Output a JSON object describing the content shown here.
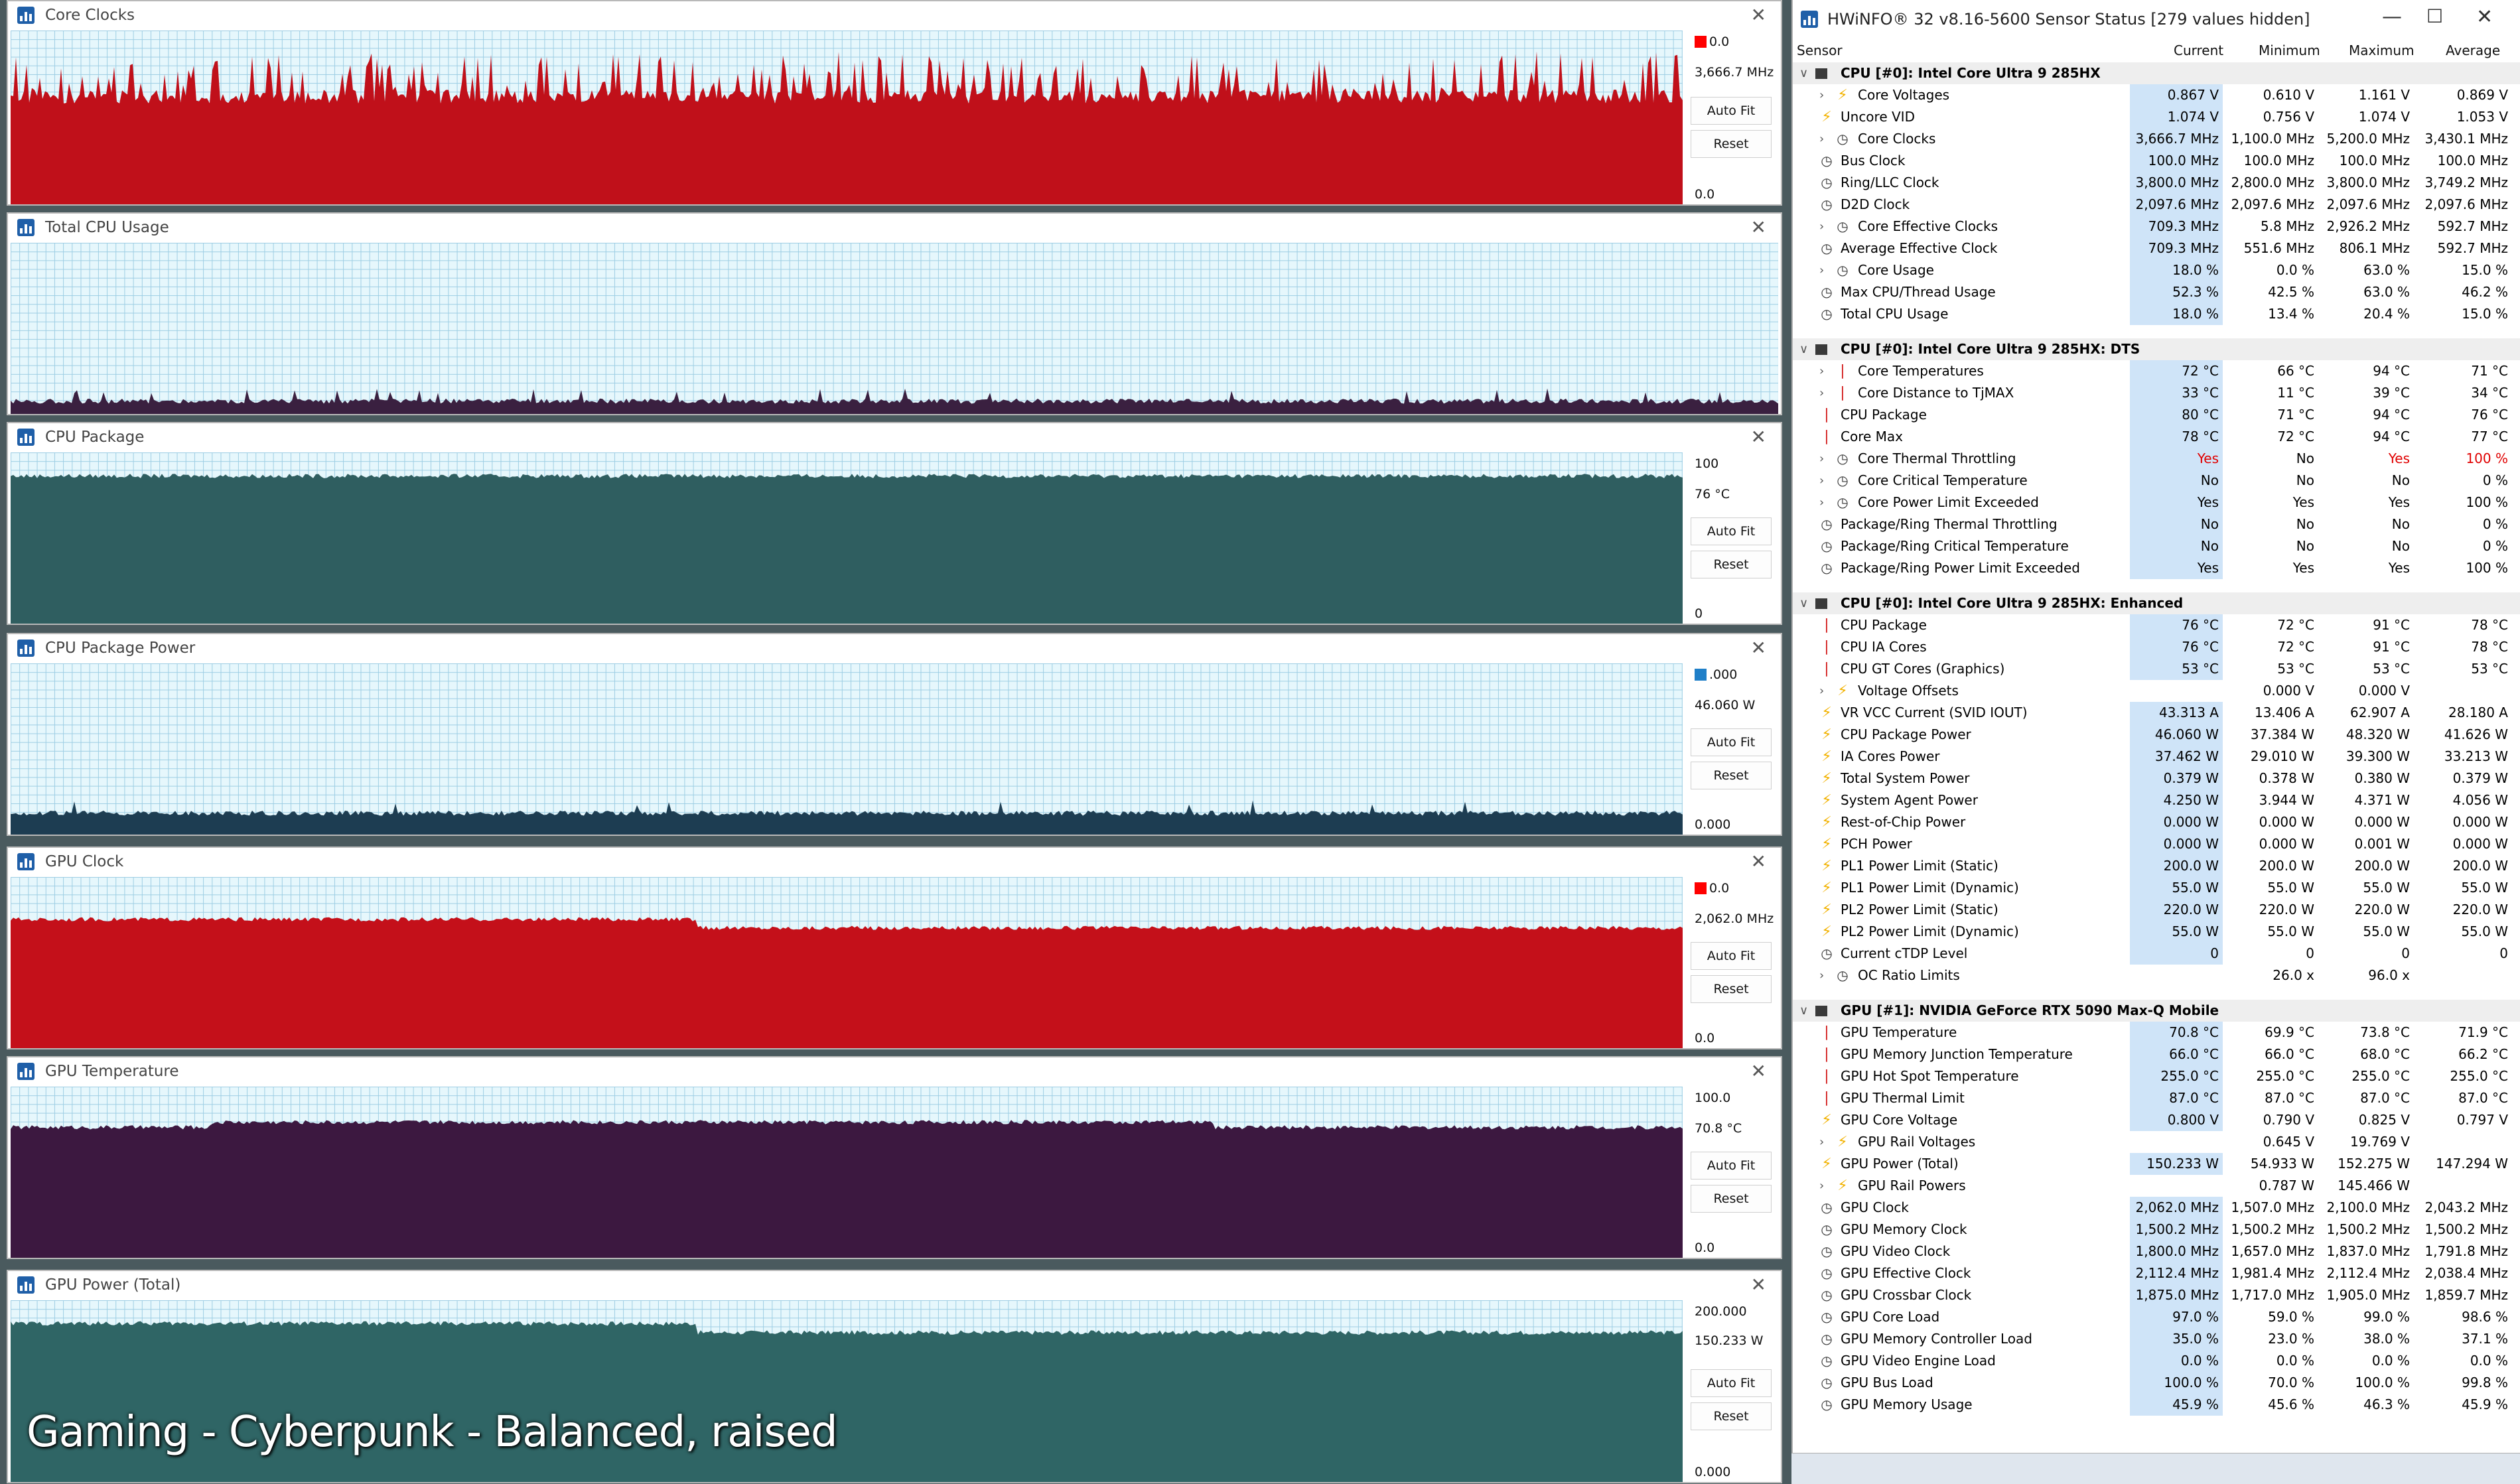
{
  "graphs": [
    {
      "title": "Core Clocks",
      "top_value": "0.0",
      "current": "3,666.7 MHz",
      "bottom_value": "0.0",
      "auto_fit": "Auto Fit",
      "reset": "Reset",
      "color": "#c0101a",
      "swatch": "#ff0000"
    },
    {
      "title": "Total CPU Usage",
      "top_value": "",
      "current": "",
      "bottom_value": "",
      "auto_fit": "",
      "reset": "",
      "color": "#3a2040",
      "swatch": ""
    },
    {
      "title": "CPU Package",
      "top_value": "100",
      "current": "76 °C",
      "bottom_value": "0",
      "auto_fit": "Auto Fit",
      "reset": "Reset",
      "color": "#2f5e60",
      "swatch": ""
    },
    {
      "title": "CPU Package Power",
      "top_value": ".000",
      "current": "46.060 W",
      "bottom_value": "0.000",
      "auto_fit": "Auto Fit",
      "reset": "Reset",
      "color": "#1d3d52",
      "swatch": "#1f7fc8"
    },
    {
      "title": "GPU Clock",
      "top_value": "0.0",
      "current": "2,062.0 MHz",
      "bottom_value": "0.0",
      "auto_fit": "Auto Fit",
      "reset": "Reset",
      "color": "#c4101a",
      "swatch": "#ff0000"
    },
    {
      "title": "GPU Temperature",
      "top_value": "100.0",
      "current": "70.8 °C",
      "bottom_value": "0.0",
      "auto_fit": "Auto Fit",
      "reset": "Reset",
      "color": "#3c1840",
      "swatch": ""
    },
    {
      "title": "GPU Power (Total)",
      "top_value": "200.000",
      "current": "150.233 W",
      "bottom_value": "0.000",
      "auto_fit": "Auto Fit",
      "reset": "Reset",
      "color": "#2f6565",
      "swatch": ""
    }
  ],
  "caption": "Gaming - Cyberpunk - Balanced, raised",
  "sensor_window": {
    "title": "HWiNFO® 32 v8.16-5600 Sensor Status [279 values hidden]",
    "columns": {
      "sensor": "Sensor",
      "current": "Current",
      "minimum": "Minimum",
      "maximum": "Maximum",
      "average": "Average"
    },
    "groups": [
      {
        "name": "CPU [#0]: Intel Core Ultra 9 285HX",
        "rows": [
          {
            "icon": "bolt",
            "expand": true,
            "name": "Core Voltages",
            "cur": "0.867 V",
            "min": "0.610 V",
            "max": "1.161 V",
            "avg": "0.869 V"
          },
          {
            "icon": "bolt",
            "expand": false,
            "name": "Uncore VID",
            "cur": "1.074 V",
            "min": "0.756 V",
            "max": "1.074 V",
            "avg": "1.053 V"
          },
          {
            "icon": "clock",
            "expand": true,
            "name": "Core Clocks",
            "cur": "3,666.7 MHz",
            "min": "1,100.0 MHz",
            "max": "5,200.0 MHz",
            "avg": "3,430.1 MHz"
          },
          {
            "icon": "clock",
            "expand": false,
            "name": "Bus Clock",
            "cur": "100.0 MHz",
            "min": "100.0 MHz",
            "max": "100.0 MHz",
            "avg": "100.0 MHz"
          },
          {
            "icon": "clock",
            "expand": false,
            "name": "Ring/LLC Clock",
            "cur": "3,800.0 MHz",
            "min": "2,800.0 MHz",
            "max": "3,800.0 MHz",
            "avg": "3,749.2 MHz"
          },
          {
            "icon": "clock",
            "expand": false,
            "name": "D2D Clock",
            "cur": "2,097.6 MHz",
            "min": "2,097.6 MHz",
            "max": "2,097.6 MHz",
            "avg": "2,097.6 MHz"
          },
          {
            "icon": "clock",
            "expand": true,
            "name": "Core Effective Clocks",
            "cur": "709.3 MHz",
            "min": "5.8 MHz",
            "max": "2,926.2 MHz",
            "avg": "592.7 MHz"
          },
          {
            "icon": "clock",
            "expand": false,
            "name": "Average Effective Clock",
            "cur": "709.3 MHz",
            "min": "551.6 MHz",
            "max": "806.1 MHz",
            "avg": "592.7 MHz"
          },
          {
            "icon": "clock",
            "expand": true,
            "name": "Core Usage",
            "cur": "18.0 %",
            "min": "0.0 %",
            "max": "63.0 %",
            "avg": "15.0 %"
          },
          {
            "icon": "clock",
            "expand": false,
            "name": "Max CPU/Thread Usage",
            "cur": "52.3 %",
            "min": "42.5 %",
            "max": "63.0 %",
            "avg": "46.2 %"
          },
          {
            "icon": "clock",
            "expand": false,
            "name": "Total CPU Usage",
            "cur": "18.0 %",
            "min": "13.4 %",
            "max": "20.4 %",
            "avg": "15.0 %"
          }
        ]
      },
      {
        "name": "CPU [#0]: Intel Core Ultra 9 285HX: DTS",
        "rows": [
          {
            "icon": "therm",
            "expand": true,
            "name": "Core Temperatures",
            "cur": "72 °C",
            "min": "66 °C",
            "max": "94 °C",
            "avg": "71 °C"
          },
          {
            "icon": "therm",
            "expand": true,
            "name": "Core Distance to TjMAX",
            "cur": "33 °C",
            "min": "11 °C",
            "max": "39 °C",
            "avg": "34 °C"
          },
          {
            "icon": "therm",
            "expand": false,
            "name": "CPU Package",
            "cur": "80 °C",
            "min": "71 °C",
            "max": "94 °C",
            "avg": "76 °C"
          },
          {
            "icon": "therm",
            "expand": false,
            "name": "Core Max",
            "cur": "78 °C",
            "min": "72 °C",
            "max": "94 °C",
            "avg": "77 °C"
          },
          {
            "icon": "clock",
            "expand": true,
            "name": "Core Thermal Throttling",
            "cur": "Yes",
            "min": "No",
            "max": "Yes",
            "avg": "100 %",
            "red": true
          },
          {
            "icon": "clock",
            "expand": true,
            "name": "Core Critical Temperature",
            "cur": "No",
            "min": "No",
            "max": "No",
            "avg": "0 %"
          },
          {
            "icon": "clock",
            "expand": true,
            "name": "Core Power Limit Exceeded",
            "cur": "Yes",
            "min": "Yes",
            "max": "Yes",
            "avg": "100 %"
          },
          {
            "icon": "clock",
            "expand": false,
            "name": "Package/Ring Thermal Throttling",
            "cur": "No",
            "min": "No",
            "max": "No",
            "avg": "0 %"
          },
          {
            "icon": "clock",
            "expand": false,
            "name": "Package/Ring Critical Temperature",
            "cur": "No",
            "min": "No",
            "max": "No",
            "avg": "0 %"
          },
          {
            "icon": "clock",
            "expand": false,
            "name": "Package/Ring Power Limit Exceeded",
            "cur": "Yes",
            "min": "Yes",
            "max": "Yes",
            "avg": "100 %"
          }
        ]
      },
      {
        "name": "CPU [#0]: Intel Core Ultra 9 285HX: Enhanced",
        "rows": [
          {
            "icon": "therm",
            "expand": false,
            "name": "CPU Package",
            "cur": "76 °C",
            "min": "72 °C",
            "max": "91 °C",
            "avg": "78 °C"
          },
          {
            "icon": "therm",
            "expand": false,
            "name": "CPU IA Cores",
            "cur": "76 °C",
            "min": "72 °C",
            "max": "91 °C",
            "avg": "78 °C"
          },
          {
            "icon": "therm",
            "expand": false,
            "name": "CPU GT Cores (Graphics)",
            "cur": "53 °C",
            "min": "53 °C",
            "max": "53 °C",
            "avg": "53 °C"
          },
          {
            "icon": "bolt",
            "expand": true,
            "name": "Voltage Offsets",
            "cur": "",
            "min": "0.000 V",
            "max": "0.000 V",
            "avg": ""
          },
          {
            "icon": "bolt",
            "expand": false,
            "name": "VR VCC Current (SVID IOUT)",
            "cur": "43.313 A",
            "min": "13.406 A",
            "max": "62.907 A",
            "avg": "28.180 A"
          },
          {
            "icon": "bolt",
            "expand": false,
            "name": "CPU Package Power",
            "cur": "46.060 W",
            "min": "37.384 W",
            "max": "48.320 W",
            "avg": "41.626 W"
          },
          {
            "icon": "bolt",
            "expand": false,
            "name": "IA Cores Power",
            "cur": "37.462 W",
            "min": "29.010 W",
            "max": "39.300 W",
            "avg": "33.213 W"
          },
          {
            "icon": "bolt",
            "expand": false,
            "name": "Total System Power",
            "cur": "0.379 W",
            "min": "0.378 W",
            "max": "0.380 W",
            "avg": "0.379 W"
          },
          {
            "icon": "bolt",
            "expand": false,
            "name": "System Agent Power",
            "cur": "4.250 W",
            "min": "3.944 W",
            "max": "4.371 W",
            "avg": "4.056 W"
          },
          {
            "icon": "bolt",
            "expand": false,
            "name": "Rest-of-Chip Power",
            "cur": "0.000 W",
            "min": "0.000 W",
            "max": "0.000 W",
            "avg": "0.000 W"
          },
          {
            "icon": "bolt",
            "expand": false,
            "name": "PCH Power",
            "cur": "0.000 W",
            "min": "0.000 W",
            "max": "0.001 W",
            "avg": "0.000 W"
          },
          {
            "icon": "bolt",
            "expand": false,
            "name": "PL1 Power Limit (Static)",
            "cur": "200.0 W",
            "min": "200.0 W",
            "max": "200.0 W",
            "avg": "200.0 W"
          },
          {
            "icon": "bolt",
            "expand": false,
            "name": "PL1 Power Limit (Dynamic)",
            "cur": "55.0 W",
            "min": "55.0 W",
            "max": "55.0 W",
            "avg": "55.0 W"
          },
          {
            "icon": "bolt",
            "expand": false,
            "name": "PL2 Power Limit (Static)",
            "cur": "220.0 W",
            "min": "220.0 W",
            "max": "220.0 W",
            "avg": "220.0 W"
          },
          {
            "icon": "bolt",
            "expand": false,
            "name": "PL2 Power Limit (Dynamic)",
            "cur": "55.0 W",
            "min": "55.0 W",
            "max": "55.0 W",
            "avg": "55.0 W"
          },
          {
            "icon": "clock",
            "expand": false,
            "name": "Current cTDP Level",
            "cur": "0",
            "min": "0",
            "max": "0",
            "avg": "0"
          },
          {
            "icon": "clock",
            "expand": true,
            "name": "OC Ratio Limits",
            "cur": "",
            "min": "26.0 x",
            "max": "96.0 x",
            "avg": ""
          }
        ]
      },
      {
        "name": "GPU [#1]: NVIDIA  GeForce RTX 5090 Max-Q Mobile",
        "rows": [
          {
            "icon": "therm",
            "expand": false,
            "name": "GPU Temperature",
            "cur": "70.8 °C",
            "min": "69.9 °C",
            "max": "73.8 °C",
            "avg": "71.9 °C"
          },
          {
            "icon": "therm",
            "expand": false,
            "name": "GPU Memory Junction Temperature",
            "cur": "66.0 °C",
            "min": "66.0 °C",
            "max": "68.0 °C",
            "avg": "66.2 °C"
          },
          {
            "icon": "therm",
            "expand": false,
            "name": "GPU Hot Spot Temperature",
            "cur": "255.0 °C",
            "min": "255.0 °C",
            "max": "255.0 °C",
            "avg": "255.0 °C"
          },
          {
            "icon": "therm",
            "expand": false,
            "name": "GPU Thermal Limit",
            "cur": "87.0 °C",
            "min": "87.0 °C",
            "max": "87.0 °C",
            "avg": "87.0 °C"
          },
          {
            "icon": "bolt",
            "expand": false,
            "name": "GPU Core Voltage",
            "cur": "0.800 V",
            "min": "0.790 V",
            "max": "0.825 V",
            "avg": "0.797 V"
          },
          {
            "icon": "bolt",
            "expand": true,
            "name": "GPU Rail Voltages",
            "cur": "",
            "min": "0.645 V",
            "max": "19.769 V",
            "avg": ""
          },
          {
            "icon": "bolt",
            "expand": false,
            "name": "GPU Power (Total)",
            "cur": "150.233 W",
            "min": "54.933 W",
            "max": "152.275 W",
            "avg": "147.294 W"
          },
          {
            "icon": "bolt",
            "expand": true,
            "name": "GPU Rail Powers",
            "cur": "",
            "min": "0.787 W",
            "max": "145.466 W",
            "avg": ""
          },
          {
            "icon": "clock",
            "expand": false,
            "name": "GPU Clock",
            "cur": "2,062.0 MHz",
            "min": "1,507.0 MHz",
            "max": "2,100.0 MHz",
            "avg": "2,043.2 MHz"
          },
          {
            "icon": "clock",
            "expand": false,
            "name": "GPU Memory Clock",
            "cur": "1,500.2 MHz",
            "min": "1,500.2 MHz",
            "max": "1,500.2 MHz",
            "avg": "1,500.2 MHz"
          },
          {
            "icon": "clock",
            "expand": false,
            "name": "GPU Video Clock",
            "cur": "1,800.0 MHz",
            "min": "1,657.0 MHz",
            "max": "1,837.0 MHz",
            "avg": "1,791.8 MHz"
          },
          {
            "icon": "clock",
            "expand": false,
            "name": "GPU Effective Clock",
            "cur": "2,112.4 MHz",
            "min": "1,981.4 MHz",
            "max": "2,112.4 MHz",
            "avg": "2,038.4 MHz"
          },
          {
            "icon": "clock",
            "expand": false,
            "name": "GPU Crossbar Clock",
            "cur": "1,875.0 MHz",
            "min": "1,717.0 MHz",
            "max": "1,905.0 MHz",
            "avg": "1,859.7 MHz"
          },
          {
            "icon": "clock",
            "expand": false,
            "name": "GPU Core Load",
            "cur": "97.0 %",
            "min": "59.0 %",
            "max": "99.0 %",
            "avg": "98.6 %"
          },
          {
            "icon": "clock",
            "expand": false,
            "name": "GPU Memory Controller Load",
            "cur": "35.0 %",
            "min": "23.0 %",
            "max": "38.0 %",
            "avg": "37.1 %"
          },
          {
            "icon": "clock",
            "expand": false,
            "name": "GPU Video Engine Load",
            "cur": "0.0 %",
            "min": "0.0 %",
            "max": "0.0 %",
            "avg": "0.0 %"
          },
          {
            "icon": "clock",
            "expand": false,
            "name": "GPU Bus Load",
            "cur": "100.0 %",
            "min": "70.0 %",
            "max": "100.0 %",
            "avg": "99.8 %"
          },
          {
            "icon": "clock",
            "expand": false,
            "name": "GPU Memory Usage",
            "cur": "45.9 %",
            "min": "45.6 %",
            "max": "46.3 %",
            "avg": "45.9 %"
          }
        ]
      }
    ]
  }
}
